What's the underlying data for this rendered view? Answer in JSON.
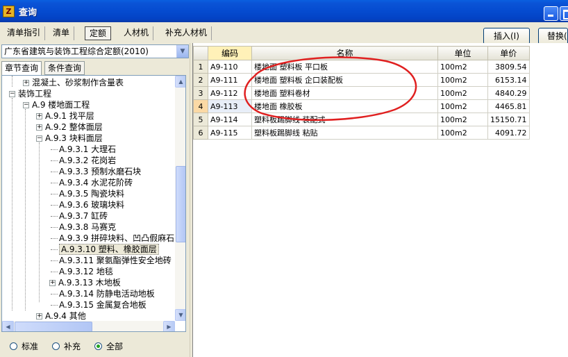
{
  "window": {
    "title": "查询",
    "icon_char": "Z"
  },
  "tabs": [
    {
      "label": "清单指引"
    },
    {
      "label": "清单"
    },
    {
      "label": "定额"
    },
    {
      "label": "人材机"
    },
    {
      "label": "补充人材机"
    }
  ],
  "toolbar": {
    "insert_label": "插入(I)",
    "replace_label": "替换("
  },
  "left": {
    "quota_selected": "广东省建筑与装饰工程综合定额(2010)",
    "subtabs": [
      "章节查询",
      "条件查询"
    ],
    "tree": [
      {
        "label": "混凝土、砂浆制作含量表",
        "expander": "+"
      },
      {
        "label": "装饰工程",
        "expander": "−"
      },
      {
        "label": "A.9 楼地面工程",
        "expander": "−"
      },
      {
        "label": "A.9.1 找平层",
        "expander": "+"
      },
      {
        "label": "A.9.2 整体面层",
        "expander": "+"
      },
      {
        "label": "A.9.3 块料面层",
        "expander": "−"
      },
      {
        "label": "A.9.3.1 大理石"
      },
      {
        "label": "A.9.3.2 花岗岩"
      },
      {
        "label": "A.9.3.3 预制水磨石块"
      },
      {
        "label": "A.9.3.4 水泥花阶砖"
      },
      {
        "label": "A.9.3.5 陶瓷块料"
      },
      {
        "label": "A.9.3.6 玻璃块料"
      },
      {
        "label": "A.9.3.7 缸砖"
      },
      {
        "label": "A.9.3.8 马赛克"
      },
      {
        "label": "A.9.3.9 拼碎块料、凹凸假麻石"
      },
      {
        "label": "A.9.3.10 塑料、橡胶面层"
      },
      {
        "label": "A.9.3.11 聚氨酯弹性安全地砖"
      },
      {
        "label": "A.9.3.12 地毯"
      },
      {
        "label": "A.9.3.13 木地板",
        "expander": "+"
      },
      {
        "label": "A.9.3.14 防静电活动地板"
      },
      {
        "label": "A.9.3.15 金属复合地板"
      },
      {
        "label": "A.9.4 其他",
        "expander": "+"
      }
    ],
    "radios": [
      {
        "label": "标准",
        "checked": false
      },
      {
        "label": "补充",
        "checked": false
      },
      {
        "label": "全部",
        "checked": true
      }
    ]
  },
  "grid": {
    "headers": {
      "code": "编码",
      "name": "名称",
      "unit": "单位",
      "price": "单价"
    },
    "rows": [
      {
        "idx": "1",
        "code": "A9-110",
        "name": "楼地面 塑料板 平口板",
        "unit": "100m2",
        "price": "3809.54"
      },
      {
        "idx": "2",
        "code": "A9-111",
        "name": "楼地面 塑料板 企口装配板",
        "unit": "100m2",
        "price": "6153.14"
      },
      {
        "idx": "3",
        "code": "A9-112",
        "name": "楼地面 塑料卷材",
        "unit": "100m2",
        "price": "4840.29"
      },
      {
        "idx": "4",
        "code": "A9-113",
        "name": "楼地面 橡胶板",
        "unit": "100m2",
        "price": "4465.81"
      },
      {
        "idx": "5",
        "code": "A9-114",
        "name": "塑料板踢脚线 装配式",
        "unit": "100m2",
        "price": "15150.71"
      },
      {
        "idx": "6",
        "code": "A9-115",
        "name": "塑料板踢脚线 粘贴",
        "unit": "100m2",
        "price": "4091.72"
      }
    ]
  },
  "colors": {
    "annotation": "#e02020",
    "titlebar": "#0a53d6",
    "current_row": "#fbd9a5"
  }
}
